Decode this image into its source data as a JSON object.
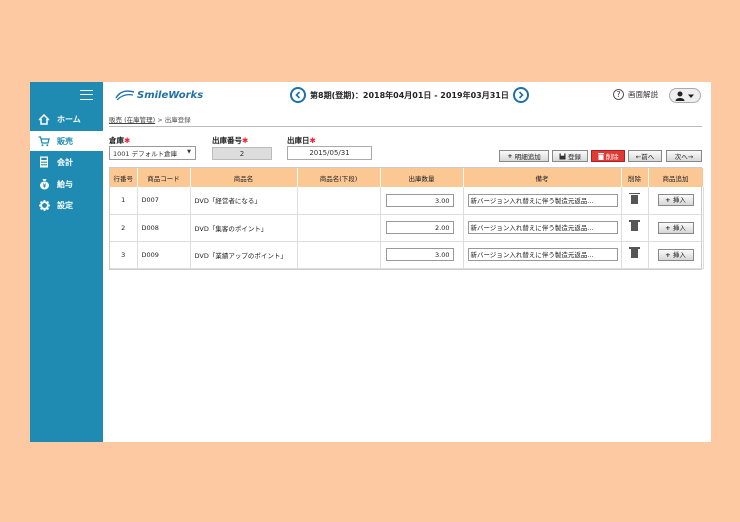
{
  "sidebar": {
    "items": [
      {
        "label": "ホーム",
        "icon": "home-icon"
      },
      {
        "label": "販売",
        "icon": "cart-icon"
      },
      {
        "label": "会計",
        "icon": "calculator-icon"
      },
      {
        "label": "給与",
        "icon": "money-bag-icon"
      },
      {
        "label": "設定",
        "icon": "gear-icon"
      }
    ],
    "active_index": 1
  },
  "header": {
    "logo": "SmileWorks",
    "period": "第8期(登期)：2018年04月01日 - 2019年03月31日",
    "help": "画面解説"
  },
  "breadcrumb": {
    "link": "販売 (在庫管理)",
    "separator": ">",
    "current": "出庫登録"
  },
  "form": {
    "warehouse_label": "倉庫",
    "warehouse_value": "1001 デフォルト倉庫",
    "shipno_label": "出庫番号",
    "shipno_value": "2",
    "date_label": "出庫日",
    "date_value": "2015/05/31",
    "required_mark": "✱"
  },
  "toolbar": {
    "add_line": "明細追加",
    "register": "登録",
    "delete": "削除",
    "prev": "←前へ",
    "next": "次へ→"
  },
  "table": {
    "headers": [
      "行番号",
      "商品コード",
      "商品名",
      "商品名(下段)",
      "出庫数量",
      "備考",
      "削除",
      "商品追加"
    ],
    "insert_label": "挿入",
    "rows": [
      {
        "no": "1",
        "code": "D007",
        "name": "DVD「経営者になる」",
        "name2": "",
        "qty": "3.00",
        "note": "新バージョン入れ替えに伴う製造元返品..."
      },
      {
        "no": "2",
        "code": "D008",
        "name": "DVD「集客のポイント」",
        "name2": "",
        "qty": "2.00",
        "note": "新バージョン入れ替えに伴う製造元返品..."
      },
      {
        "no": "3",
        "code": "D009",
        "name": "DVD「業績アップのポイント」",
        "name2": "",
        "qty": "3.00",
        "note": "新バージョン入れ替えに伴う製造元返品..."
      }
    ]
  },
  "colors": {
    "sidebar": "#1f8bb2",
    "header_row": "#fbc894",
    "delete_button": "#e03a35",
    "background": "#fdc9a2"
  }
}
